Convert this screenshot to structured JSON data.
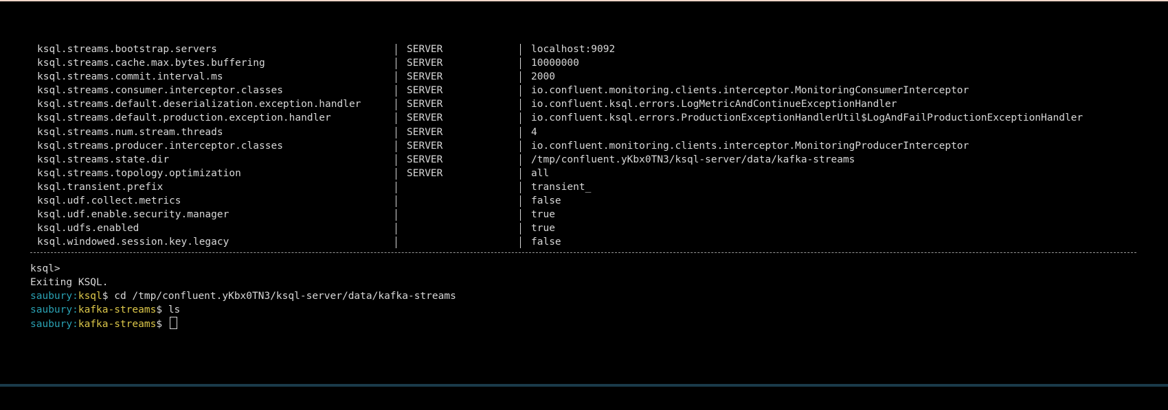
{
  "properties": [
    {
      "name": "ksql.streams.bootstrap.servers",
      "source": "SERVER",
      "value": "localhost:9092"
    },
    {
      "name": "ksql.streams.cache.max.bytes.buffering",
      "source": "SERVER",
      "value": "10000000"
    },
    {
      "name": "ksql.streams.commit.interval.ms",
      "source": "SERVER",
      "value": "2000"
    },
    {
      "name": "ksql.streams.consumer.interceptor.classes",
      "source": "SERVER",
      "value": "io.confluent.monitoring.clients.interceptor.MonitoringConsumerInterceptor"
    },
    {
      "name": "ksql.streams.default.deserialization.exception.handler",
      "source": "SERVER",
      "value": "io.confluent.ksql.errors.LogMetricAndContinueExceptionHandler"
    },
    {
      "name": "ksql.streams.default.production.exception.handler",
      "source": "SERVER",
      "value": "io.confluent.ksql.errors.ProductionExceptionHandlerUtil$LogAndFailProductionExceptionHandler"
    },
    {
      "name": "ksql.streams.num.stream.threads",
      "source": "SERVER",
      "value": "4"
    },
    {
      "name": "ksql.streams.producer.interceptor.classes",
      "source": "SERVER",
      "value": "io.confluent.monitoring.clients.interceptor.MonitoringProducerInterceptor"
    },
    {
      "name": "ksql.streams.state.dir",
      "source": "SERVER",
      "value": "/tmp/confluent.yKbx0TN3/ksql-server/data/kafka-streams"
    },
    {
      "name": "ksql.streams.topology.optimization",
      "source": "SERVER",
      "value": "all"
    },
    {
      "name": "ksql.transient.prefix",
      "source": "",
      "value": "transient_"
    },
    {
      "name": "ksql.udf.collect.metrics",
      "source": "",
      "value": "false"
    },
    {
      "name": "ksql.udf.enable.security.manager",
      "source": "",
      "value": "true"
    },
    {
      "name": "ksql.udfs.enabled",
      "source": "",
      "value": "true"
    },
    {
      "name": "ksql.windowed.session.key.legacy",
      "source": "",
      "value": "false"
    }
  ],
  "shell": {
    "ksql_prompt": "ksql>",
    "exit_message": "Exiting KSQL.",
    "lines": [
      {
        "user": "saubury:",
        "dir": "ksql",
        "suffix": "$ ",
        "command": "cd /tmp/confluent.yKbx0TN3/ksql-server/data/kafka-streams"
      },
      {
        "user": "saubury:",
        "dir": "kafka-streams",
        "suffix": "$ ",
        "command": "ls"
      },
      {
        "user": "saubury:",
        "dir": "kafka-streams",
        "suffix": "$ ",
        "command": ""
      }
    ]
  },
  "colors": {
    "background": "#000000",
    "text": "#d8d8d8",
    "user": "#2aa1b3",
    "dir": "#dcc74a"
  }
}
